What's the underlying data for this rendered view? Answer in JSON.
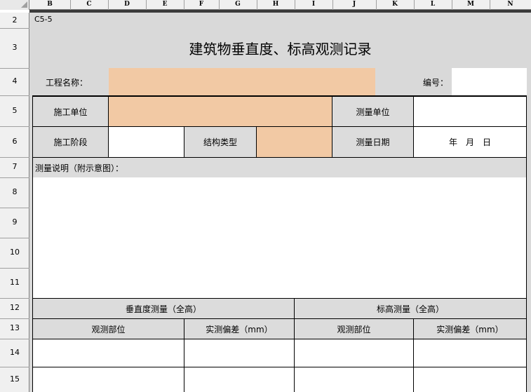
{
  "columns": [
    "B",
    "C",
    "D",
    "E",
    "F",
    "G",
    "H",
    "I",
    "J",
    "K",
    "L",
    "M",
    "N"
  ],
  "rows": [
    "2",
    "3",
    "4",
    "5",
    "6",
    "7",
    "8",
    "9",
    "10",
    "11",
    "12",
    "13",
    "14",
    "15"
  ],
  "form": {
    "code": "C5-5",
    "title": "建筑物垂直度、标高观测记录",
    "project_name_label": "工程名称：",
    "number_label": "编号：",
    "construction_unit_label": "施工单位",
    "survey_unit_label": "测量单位",
    "construction_stage_label": "施工阶段",
    "structure_type_label": "结构类型",
    "survey_date_label": "测量日期",
    "survey_date_value": "年　月　日",
    "survey_note_label": "测量说明（附示意图）：",
    "verticality_header": "垂直度测量（全高）",
    "elevation_header": "标高测量（全高）",
    "observe_part_1": "观测部位",
    "deviation_1": "实测偏差（mm）",
    "observe_part_2": "观测部位",
    "deviation_2": "实测偏差（mm）"
  },
  "colors": {
    "input_fill": "#f2c9a4",
    "sheet_background": "#d9d9d9",
    "header_fill": "#dcdcdc"
  }
}
